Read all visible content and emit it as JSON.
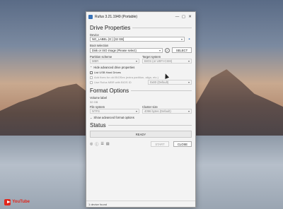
{
  "window": {
    "title": "Rufus 3.21.1949 (Portable)",
    "min": "—",
    "max": "▢",
    "close": "✕"
  },
  "drive_properties": {
    "heading": "Drive Properties",
    "device_label": "Device",
    "device_value": "NO_LABEL (G:) [32 GB]",
    "boot_label": "Boot selection",
    "boot_value": "Disk or ISO image (Please select)",
    "select_button": "SELECT",
    "partition_label": "Partition scheme",
    "partition_value": "MBR",
    "target_label": "Target system",
    "target_value": "BIOS (or UEFI-CSM)",
    "advanced_toggle": "Hide advanced drive properties",
    "list_usb": "List USB Hard Drives",
    "add_fixes": "Add fixes for old BIOSes (extra partition, align, etc.)",
    "use_rufus_mbr": "Use Rufus MBR with BIOS ID",
    "bios_id_value": "0x80 (Default)"
  },
  "format_options": {
    "heading": "Format Options",
    "volume_label": "Volume label",
    "volume_value": "32 GB",
    "fs_label": "File system",
    "fs_value": "NTFS",
    "cluster_label": "Cluster size",
    "cluster_value": "4096 bytes (Default)",
    "advanced_toggle": "Show advanced format options"
  },
  "status": {
    "heading": "Status",
    "value": "READY",
    "start_button": "START",
    "close_button": "CLOSE",
    "footer": "1 device found"
  },
  "icons": {
    "globe": "globe-icon",
    "info": "info-icon",
    "settings": "settings-icon",
    "log": "log-icon"
  },
  "watermark": "YouTube"
}
